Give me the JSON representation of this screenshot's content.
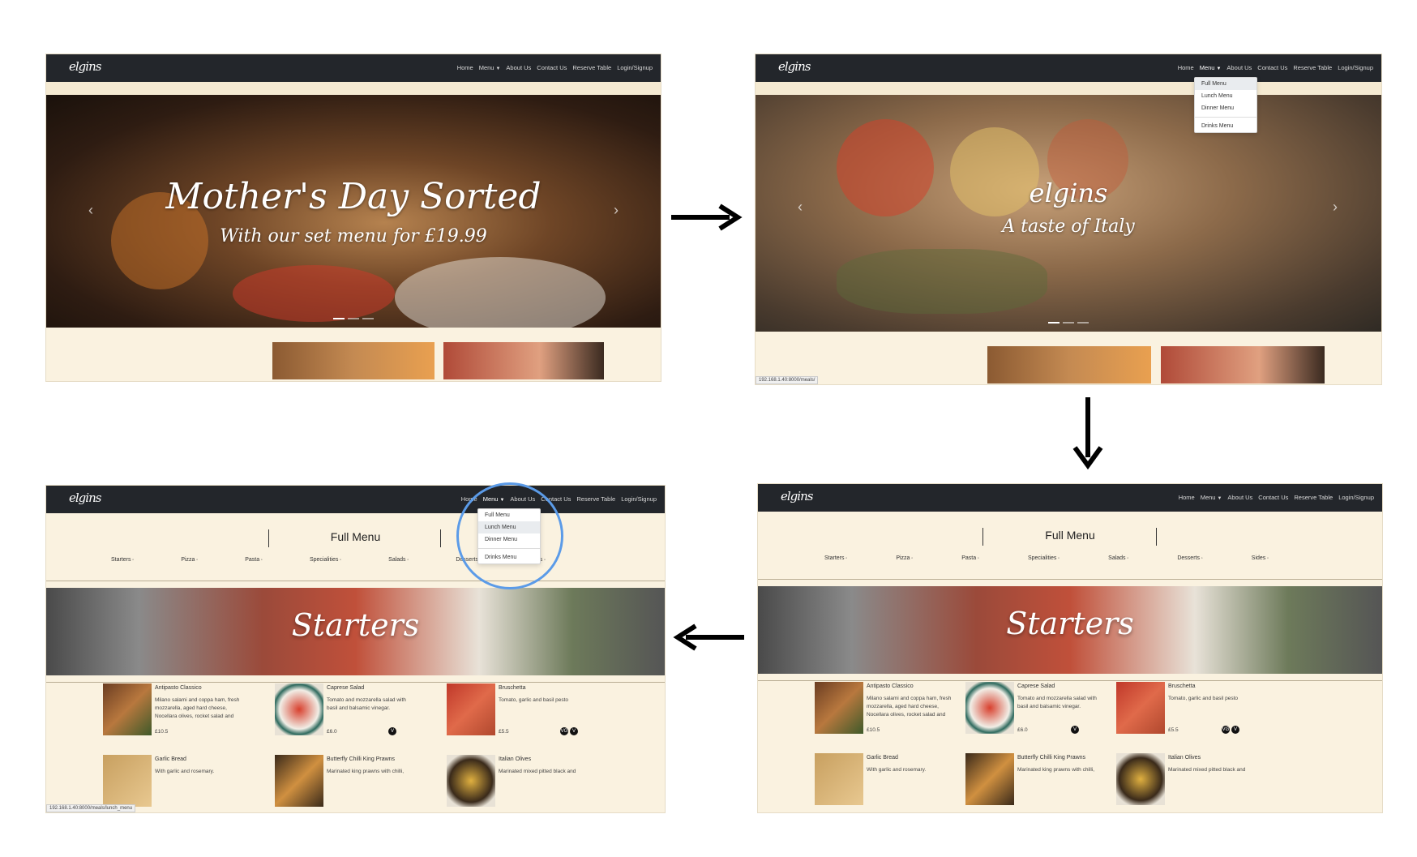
{
  "nav": {
    "logo": "elgins",
    "links": [
      "Home",
      "Menu",
      "About Us",
      "Contact Us",
      "Reserve Table",
      "Login/Signup"
    ]
  },
  "dropdown": {
    "items": [
      "Full Menu",
      "Lunch Menu",
      "Dinner Menu"
    ],
    "extra": "Drinks Menu"
  },
  "slide1": {
    "line1": "Mother's Day Sorted",
    "line2": "With our set menu for £19.99"
  },
  "slide2": {
    "line1": "elgins",
    "line2": "A taste of Italy"
  },
  "status": {
    "meals": "192.168.1.40:8000/meals/",
    "lunch": "192.168.1.40:8000/meals/lunch_menu"
  },
  "menu_page": {
    "heading": "Full Menu",
    "categories": [
      "Starters",
      "Pizza",
      "Pasta",
      "Specialities",
      "Salads",
      "Desserts",
      "Sides"
    ],
    "section_title": "Starters",
    "items": [
      {
        "name": "Antipasto Classico",
        "desc": "Milano salami and coppa ham, fresh mozzarella, aged hard cheese, Nocellara olives, rocket salad and",
        "price": "£10.5"
      },
      {
        "name": "Caprese Salad",
        "desc": "Tomato and mozzarella salad with basil and balsamic vinegar.",
        "price": "£6.0"
      },
      {
        "name": "Bruschetta",
        "desc": "Tomato, garlic and basil pesto",
        "price": "£5.5"
      },
      {
        "name": "Garlic Bread",
        "desc": "With garlic and rosemary.",
        "price": ""
      },
      {
        "name": "Butterfly Chilli King Prawns",
        "desc": "Marinated king prawns with chilli,",
        "price": ""
      },
      {
        "name": "Italian Olives",
        "desc": "Marinated mixed pitted black and",
        "price": ""
      }
    ],
    "badge_v": "V",
    "badge_vg": "VG"
  },
  "colors": {
    "nav": "#23262b",
    "cream": "#faf2e0",
    "highlight": "#5b9be8"
  }
}
